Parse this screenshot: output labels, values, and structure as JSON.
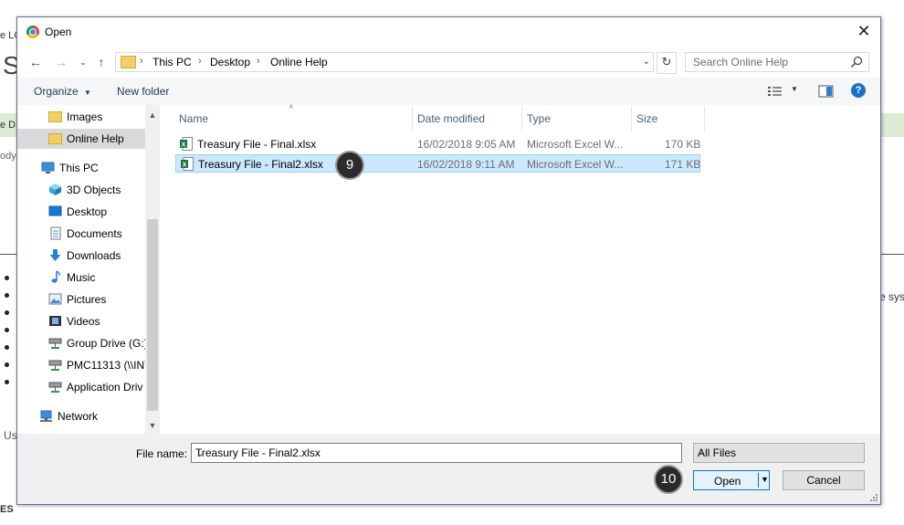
{
  "background": {
    "fragments": [
      "e LC",
      "S",
      "e D",
      "ody",
      "Us",
      "e sys",
      "ES"
    ]
  },
  "dialog": {
    "title": "Open",
    "address": {
      "crumbs": [
        "This PC",
        "Desktop",
        "Online Help"
      ]
    },
    "search": {
      "placeholder": "Search Online Help"
    },
    "toolbar": {
      "organize": "Organize",
      "new_folder": "New folder"
    },
    "nav": {
      "items": [
        {
          "label": "Images",
          "icon": "folder-icon"
        },
        {
          "label": "Online Help",
          "icon": "folder-icon",
          "selected": true
        },
        {
          "label": "This PC",
          "icon": "computer-icon"
        },
        {
          "label": "3D Objects",
          "icon": "cube-icon"
        },
        {
          "label": "Desktop",
          "icon": "desktop-icon"
        },
        {
          "label": "Documents",
          "icon": "documents-icon"
        },
        {
          "label": "Downloads",
          "icon": "download-icon"
        },
        {
          "label": "Music",
          "icon": "music-icon"
        },
        {
          "label": "Pictures",
          "icon": "pictures-icon"
        },
        {
          "label": "Videos",
          "icon": "videos-icon"
        },
        {
          "label": "Group Drive (G:)",
          "icon": "network-drive-icon"
        },
        {
          "label": "PMC11313 (\\\\INT",
          "icon": "network-drive-icon"
        },
        {
          "label": "Application Driv",
          "icon": "network-drive-icon"
        },
        {
          "label": "Network",
          "icon": "network-icon"
        }
      ]
    },
    "columns": {
      "name": "Name",
      "date": "Date modified",
      "type": "Type",
      "size": "Size"
    },
    "files": [
      {
        "name": "Treasury File - Final.xlsx",
        "date": "16/02/2018 9:05 AM",
        "type": "Microsoft Excel W...",
        "size": "170 KB"
      },
      {
        "name": "Treasury File - Final2.xlsx",
        "date": "16/02/2018 9:11 AM",
        "type": "Microsoft Excel W...",
        "size": "171 KB",
        "selected": true
      }
    ],
    "filename": {
      "label": "File name:",
      "value": "Treasury File - Final2.xlsx"
    },
    "filetype": {
      "value": "All Files"
    },
    "buttons": {
      "open": "Open",
      "cancel": "Cancel"
    },
    "callouts": [
      "9",
      "10"
    ],
    "colors": {
      "selection": "#cce8ff",
      "accent": "#0078d7",
      "help": "#1a6fc9"
    }
  }
}
